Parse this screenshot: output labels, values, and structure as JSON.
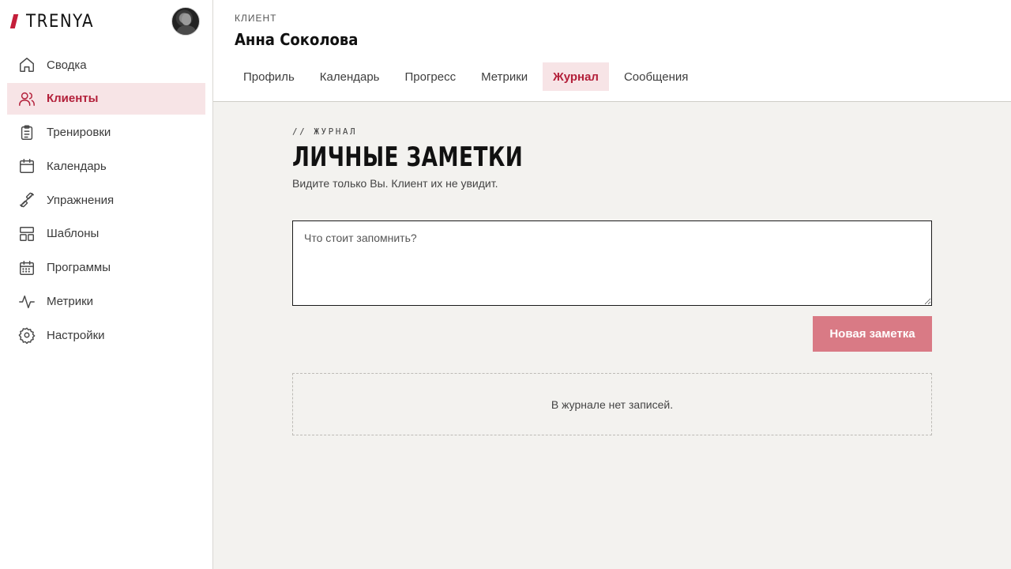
{
  "app": {
    "brand_name": "TRENYA",
    "brand_color": "#c41e3a"
  },
  "sidebar": {
    "items": [
      {
        "label": "Сводка",
        "icon": "home-icon"
      },
      {
        "label": "Клиенты",
        "icon": "users-icon",
        "active": true
      },
      {
        "label": "Тренировки",
        "icon": "clipboard-icon"
      },
      {
        "label": "Календарь",
        "icon": "calendar-icon"
      },
      {
        "label": "Упражнения",
        "icon": "dumbbell-icon"
      },
      {
        "label": "Шаблоны",
        "icon": "layout-icon"
      },
      {
        "label": "Программы",
        "icon": "calendar-grid-icon"
      },
      {
        "label": "Метрики",
        "icon": "activity-icon"
      },
      {
        "label": "Настройки",
        "icon": "gear-icon"
      }
    ]
  },
  "header": {
    "client_label": "КЛИЕНТ",
    "client_name": "Анна Соколова",
    "tabs": [
      {
        "label": "Профиль"
      },
      {
        "label": "Календарь"
      },
      {
        "label": "Прогресс"
      },
      {
        "label": "Метрики"
      },
      {
        "label": "Журнал",
        "active": true
      },
      {
        "label": "Сообщения"
      }
    ]
  },
  "main": {
    "kicker": "// ЖУРНАЛ",
    "title": "ЛИЧНЫЕ ЗАМЕТКИ",
    "subtitle": "Видите только Вы. Клиент их не увидит.",
    "note_placeholder": "Что стоит запомнить?",
    "new_note_label": "Новая заметка",
    "empty_text": "В журнале нет записей."
  },
  "colors": {
    "accent": "#b3203a",
    "active_bg": "#f7e4e6",
    "button_bg": "#d97a85",
    "page_bg": "#f3f2ef"
  }
}
